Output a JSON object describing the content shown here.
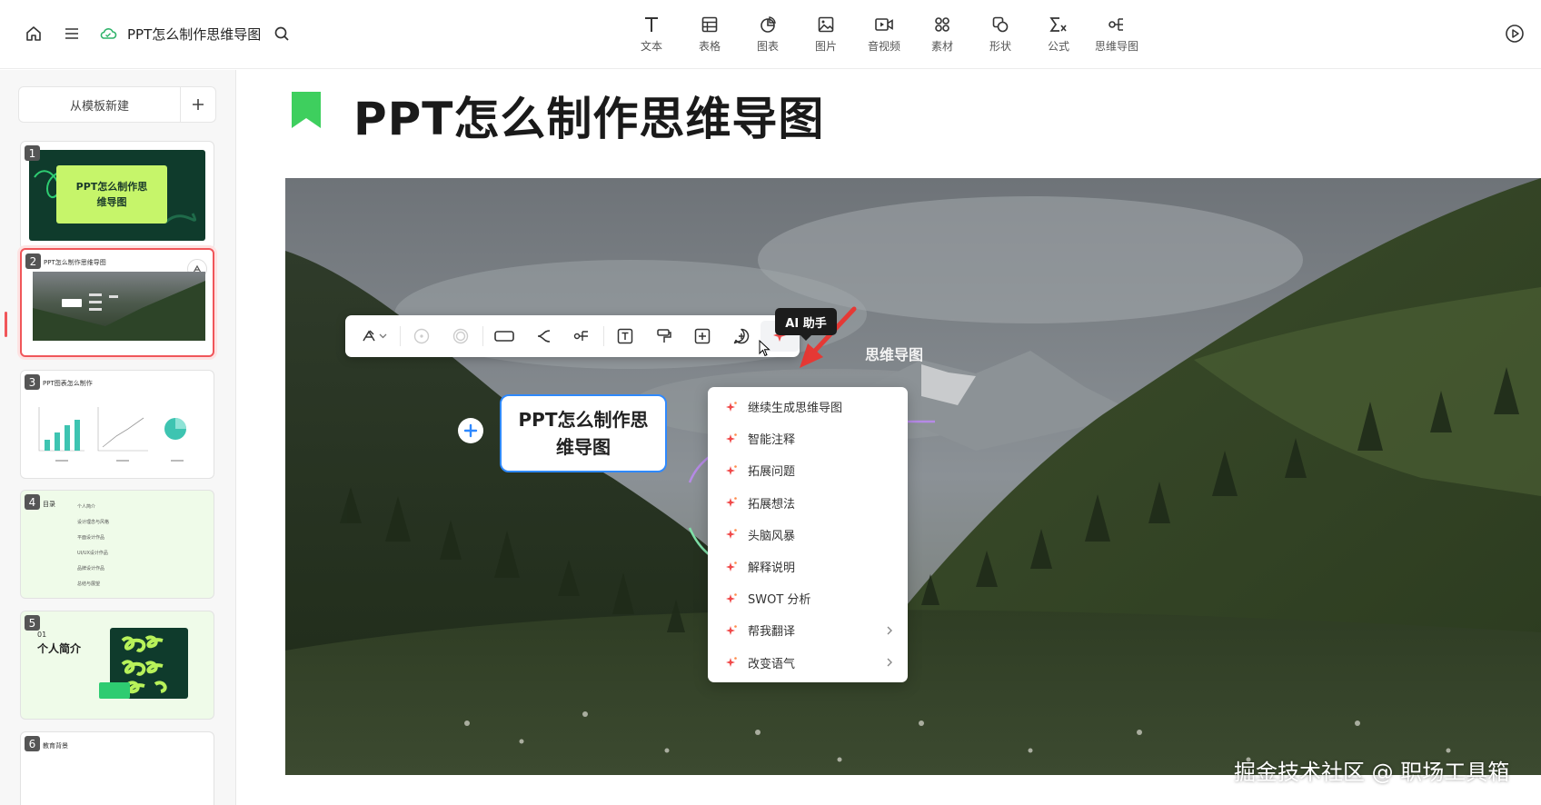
{
  "header": {
    "doc_title": "PPT怎么制作思维导图",
    "tools": [
      {
        "label": "文本",
        "icon": "text-icon"
      },
      {
        "label": "表格",
        "icon": "table-icon"
      },
      {
        "label": "图表",
        "icon": "chart-icon"
      },
      {
        "label": "图片",
        "icon": "image-icon"
      },
      {
        "label": "音视频",
        "icon": "video-icon"
      },
      {
        "label": "素材",
        "icon": "material-icon"
      },
      {
        "label": "形状",
        "icon": "shape-icon"
      },
      {
        "label": "公式",
        "icon": "formula-icon"
      },
      {
        "label": "思维导图",
        "icon": "mindmap-icon"
      }
    ]
  },
  "sidebar": {
    "new_from_template": "从模板新建",
    "slides": [
      {
        "num": "1",
        "title": "PPT怎么制作思维导图"
      },
      {
        "num": "2",
        "title": "PPT怎么制作思维导图"
      },
      {
        "num": "3",
        "title": "PPT图表怎么制作"
      },
      {
        "num": "4",
        "title": "目录",
        "items": [
          "个人简介",
          "设计理念与风格",
          "平面设计作品",
          "UI/UX设计作品",
          "品牌设计作品",
          "总结与展望"
        ]
      },
      {
        "num": "5",
        "section": "01",
        "title": "个人简介"
      },
      {
        "num": "6",
        "title": "教育背景"
      }
    ]
  },
  "slide": {
    "title": "PPT怎么制作思维导图",
    "mindmap": {
      "root": "PPT怎么制作思维导图",
      "branch": "思维导图"
    }
  },
  "ai": {
    "tooltip": "AI 助手",
    "menu": [
      {
        "label": "继续生成思维导图",
        "has_submenu": false
      },
      {
        "label": "智能注释",
        "has_submenu": false
      },
      {
        "label": "拓展问题",
        "has_submenu": false
      },
      {
        "label": "拓展想法",
        "has_submenu": false
      },
      {
        "label": "头脑风暴",
        "has_submenu": false
      },
      {
        "label": "解释说明",
        "has_submenu": false
      },
      {
        "label": "SWOT 分析",
        "has_submenu": false
      },
      {
        "label": "帮我翻译",
        "has_submenu": true
      },
      {
        "label": "改变语气",
        "has_submenu": true
      }
    ]
  },
  "watermark": "掘金技术社区 @ 职场工具箱",
  "colors": {
    "accent_red": "#f0565a",
    "node_border": "#2f89ff",
    "bookmark_green": "#3ecf5e",
    "ai_sparkle": "#f04a4a"
  }
}
